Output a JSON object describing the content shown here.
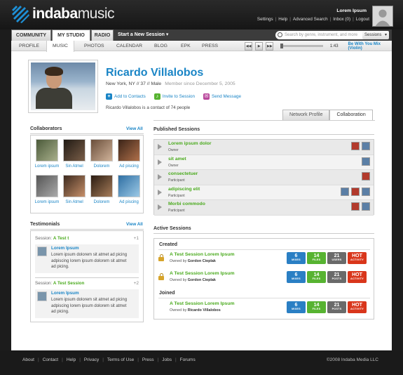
{
  "brand": {
    "word_bold": "indaba",
    "word_light": "music"
  },
  "user": {
    "name": "Lorem Ipsum"
  },
  "toplinks": [
    "Settings",
    "Help",
    "Advanced Search",
    "Inbox (0)",
    "Logout"
  ],
  "nav": {
    "tabs": [
      "COMMUNITY",
      "MY STUDIO",
      "RADIO"
    ],
    "start_session": "Start a New Session ▾",
    "search_placeholder": "Search by genre, instrument, and more",
    "sessions_dropdown": "Sessions"
  },
  "subnav": {
    "items": [
      "PROFILE",
      "MUSIC",
      "PHOTOS",
      "CALENDAR",
      "BLOG",
      "EPK",
      "PRESS"
    ]
  },
  "player": {
    "time": "1:43",
    "now_playing": "Be With You Mix (Violin)",
    "progress": 0.0
  },
  "profile": {
    "name": "Ricardo Villalobos",
    "info": "New York, NY // 37 // Male",
    "since": "Member since December 5, 2005",
    "actions": [
      "Add to Contacts",
      "Invite to Session",
      "Send Message"
    ],
    "contact_of": "Ricardo Villalobos is a contact of 74 people",
    "tabs": [
      "Network Profile",
      "Collaboration"
    ]
  },
  "collaborators": {
    "title": "Collaborators",
    "view_all": "View All",
    "names": [
      "Lorem ipsum",
      "Sin Atmel",
      "Dolorem",
      "Ad piscing",
      "Lorem ipsum",
      "Sin Atmel",
      "Dolorem",
      "Ad piscing"
    ]
  },
  "testimonials": {
    "title": "Testimonials",
    "view_all": "View All",
    "items": [
      {
        "session_label": "Session:",
        "session": "A Test t",
        "count": "+1",
        "name": "Lorem Ipsum",
        "text": "Lorem ipsum dolorem sit atmet ad picing adpiscing lorem ipsum dolorem sit atmet ad picing."
      },
      {
        "session_label": "Session:",
        "session": "A Test Session",
        "count": "+2",
        "name": "Lorem Ipsum",
        "text": "Lorem ipsum dolorem sit atmet ad picing adpiscing lorem ipsum dolorem sit atmet ad picing."
      }
    ]
  },
  "published": {
    "title": "Published Sessions",
    "items": [
      {
        "title": "Lorem ipsum dolor",
        "role": "Owner"
      },
      {
        "title": "sit amet",
        "role": "Owner"
      },
      {
        "title": "consectetuer",
        "role": "Participant"
      },
      {
        "title": "adipiscing elit",
        "role": "Participant"
      },
      {
        "title": "Morbi commodo",
        "role": "Participant"
      }
    ]
  },
  "active": {
    "title": "Active Sessions",
    "created_label": "Created",
    "joined_label": "Joined",
    "owned_by": "Owned by",
    "created": [
      {
        "title": "A Test Session Lorem Ipsum",
        "owner": "Gordon Cieplak"
      },
      {
        "title": "A Test Session Lorem Ipsum",
        "owner": "Gordon Cieplak"
      }
    ],
    "joined": [
      {
        "title": "A Test Session Lorem Ipsum",
        "owner": "Ricardo Villalobos"
      }
    ],
    "stats": {
      "mixes": "6",
      "mixes_label": "MIXES",
      "files": "14",
      "files_label": "FILES",
      "users": "21",
      "users_label": "USERS",
      "posts": "21",
      "posts_label": "POSTS",
      "hot": "HOT",
      "hot_label": "ACTIVITY"
    }
  },
  "footer": {
    "links": [
      "About",
      "Contact",
      "Help",
      "Privacy",
      "Terms of Use",
      "Press",
      "Jobs",
      "Forums"
    ],
    "copyright": "©2008 Indaba Media LLC"
  },
  "colors": {
    "accent_blue": "#1a85c6",
    "accent_green": "#4aaa1d",
    "hot_red": "#d9361b"
  }
}
